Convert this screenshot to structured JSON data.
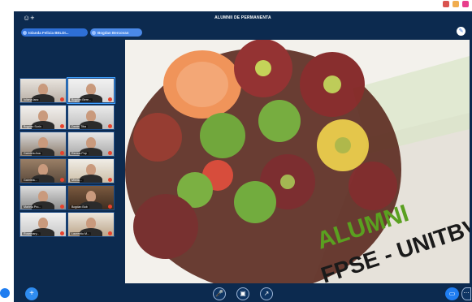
{
  "window": {
    "title": "ALUMNII DE PERMANENTA"
  },
  "participants_bar": [
    {
      "label": "Iolanda Felicia BELDI..."
    },
    {
      "label": "Bogdan Bercovan"
    }
  ],
  "grid": [
    {
      "name": "Iuliana Ianc"
    },
    {
      "name": "Bogdan Bere..."
    },
    {
      "name": "Bogdan Sorin"
    },
    {
      "name": "Daniel Tiba"
    },
    {
      "name": "Gabriela Ana"
    },
    {
      "name": "Remus Pop"
    },
    {
      "name": "Gabriela..."
    },
    {
      "name": "Mirela..."
    },
    {
      "name": "Mariela Pro..."
    },
    {
      "name": "Bogdan Bob"
    },
    {
      "name": "Rosemary..."
    },
    {
      "name": "Laurentiu M..."
    }
  ],
  "shared_content": {
    "banner_line1": "ALUMNI",
    "banner_line2": "FPSE - UNITBV"
  },
  "colors": {
    "app_bg": "#0c2a4f",
    "accent": "#2e6fd6",
    "banner_green": "#5aa020",
    "banner_dark": "#1a1a1a"
  }
}
